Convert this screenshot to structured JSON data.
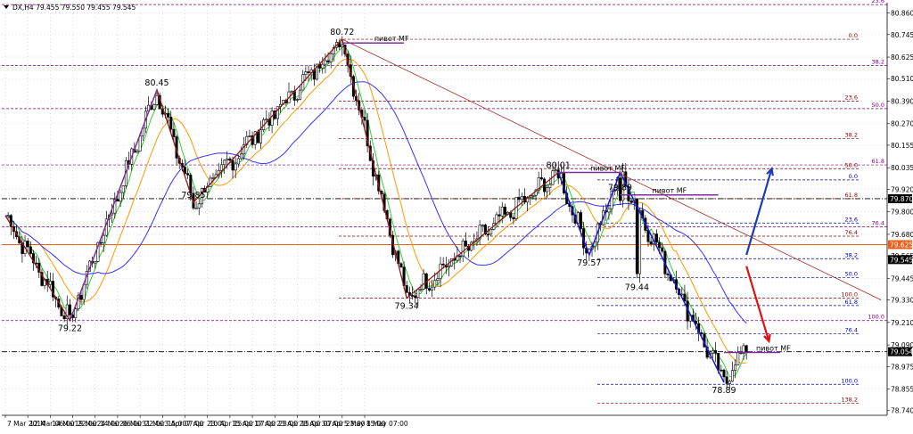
{
  "chart_data": {
    "type": "candlestick",
    "symbol_line": "DX,H4  79.455 79.550 79.455 79.545",
    "colors": {
      "grid": "#c8c8c8",
      "candle_up": "#ffffff",
      "candle_down": "#000000",
      "ma_fast": "#33cc33",
      "ma_mid": "#ff9900",
      "ma_slow": "#3333ff",
      "zigzag_major": "#8b1a1a",
      "zigzag_purple": "#7b2fa0",
      "zigzag_blue": "#1a1acc",
      "trendline": "#a52a2a",
      "fib_level": "#800080",
      "fib_blue": "#0000aa",
      "fib_brown": "#8b0000",
      "arrow_up": "#1a3cb5",
      "arrow_down": "#dd1111",
      "level_orange": "#e8601c"
    },
    "price_axis": {
      "ylim": [
        78.715,
        80.915
      ],
      "ticks": [
        "80.860",
        "80.745",
        "80.625",
        "80.510",
        "80.390",
        "80.270",
        "80.155",
        "80.035",
        "79.920",
        "79.800",
        "79.680",
        "79.565",
        "79.445",
        "79.330",
        "79.210",
        "79.090",
        "78.975",
        "78.855",
        "78.740"
      ],
      "tags": [
        {
          "label": "79.870",
          "price": 79.87,
          "color": "#000000"
        },
        {
          "label": "79.625",
          "price": 79.625,
          "color": "#e8601c"
        },
        {
          "label": "79.545",
          "price": 79.545,
          "color": "#000000"
        },
        {
          "label": "79.054",
          "price": 79.054,
          "color": "#000000"
        }
      ]
    },
    "time_axis": {
      "bars": 183,
      "ticks": [
        {
          "label": "7 Mar 2014",
          "bar": 0
        },
        {
          "label": "12 Mar 06:00",
          "bar": 16
        },
        {
          "label": "14 Mar 22:00",
          "bar": 32
        },
        {
          "label": "19 Mar 14:00",
          "bar": 48
        },
        {
          "label": "24 Mar 06:00",
          "bar": 64
        },
        {
          "label": "26 Mar 22:00",
          "bar": 80
        },
        {
          "label": "31 Mar 15:00",
          "bar": 96
        },
        {
          "label": "3 Apr 07:00",
          "bar": 112
        },
        {
          "label": "7 Apr 23:00",
          "bar": 128
        },
        {
          "label": "10 Apr 15:00",
          "bar": 144
        },
        {
          "label": "15 Apr 07:00",
          "bar": 160
        },
        {
          "label": "17 Apr 23:00",
          "bar": 176
        },
        {
          "label": "23 Apr 15:00",
          "bar": 192
        },
        {
          "label": "28 Apr 07:00",
          "bar": 208
        },
        {
          "label": "30 Apr 23:00",
          "bar": 224
        },
        {
          "label": "5 May 15:00",
          "bar": 240
        },
        {
          "label": "8 May 07:00",
          "bar": 256
        }
      ]
    },
    "swing_points": [
      {
        "label": "79.22",
        "bar": 23,
        "price": 79.22
      },
      {
        "label": "80.45",
        "bar": 54,
        "price": 80.45
      },
      {
        "label": "79.85",
        "bar": 67,
        "price": 79.85
      },
      {
        "label": "80.72",
        "bar": 120,
        "price": 80.72
      },
      {
        "label": "79.34",
        "bar": 143,
        "price": 79.34
      },
      {
        "label": "80.01",
        "bar": 197,
        "price": 80.01
      },
      {
        "label": "79.57",
        "bar": 208,
        "price": 79.57
      },
      {
        "label": "79.89",
        "bar": 219,
        "price": 79.89
      },
      {
        "label": "79.44",
        "bar": 225,
        "price": 79.44
      },
      {
        "label": "78.89",
        "bar": 256,
        "price": 78.89
      }
    ],
    "zigzag_major": [
      [
        0,
        79.78
      ],
      [
        23,
        79.22
      ],
      [
        54,
        80.45
      ],
      [
        67,
        79.85
      ],
      [
        120,
        80.72
      ],
      [
        143,
        79.34
      ],
      [
        197,
        80.01
      ],
      [
        208,
        79.57
      ],
      [
        219,
        80.01
      ],
      [
        256,
        78.89
      ]
    ],
    "zigzag_purple": [
      [
        23,
        79.22
      ],
      [
        54,
        80.45
      ]
    ],
    "trendline": [
      [
        120,
        80.72
      ],
      [
        312,
        79.33
      ]
    ],
    "pivot_labels": [
      {
        "label": "пивот MF",
        "bar": 120,
        "bar_end": 142,
        "price": 80.7
      },
      {
        "label": "пивот MF",
        "bar": 197,
        "bar_end": 219,
        "price": 80.01
      },
      {
        "label": "пивот MF",
        "bar": 219,
        "bar_end": 254,
        "price": 79.89
      },
      {
        "label": "пивот MF",
        "bar": 256,
        "bar_end": 276,
        "price": 79.05
      }
    ],
    "fib_levels": [
      {
        "label": "23.6",
        "price": 80.905,
        "color": "#800080",
        "side": "axis"
      },
      {
        "label": "38.2",
        "price": 80.58,
        "color": "#800080",
        "side": "axis"
      },
      {
        "label": "61.8",
        "price": 80.05,
        "color": "#800080",
        "side": "axis"
      },
      {
        "label": "76.4",
        "price": 79.72,
        "color": "#800080",
        "side": "axis"
      },
      {
        "label": "100.0",
        "price": 79.22,
        "color": "#800080",
        "side": "axis"
      },
      {
        "label": "0.0",
        "price": 80.72,
        "color": "#8b0000",
        "side": "mid"
      },
      {
        "label": "23.6",
        "price": 80.39,
        "color": "#8b0000",
        "side": "mid"
      },
      {
        "label": "38.2",
        "price": 80.19,
        "color": "#8b0000",
        "side": "mid"
      },
      {
        "label": "50.0",
        "price": 80.03,
        "color": "#8b0000",
        "side": "mid"
      },
      {
        "label": "61.8",
        "price": 79.87,
        "color": "#8b0000",
        "side": "mid"
      },
      {
        "label": "76.4",
        "price": 79.67,
        "color": "#8b0000",
        "side": "mid"
      },
      {
        "label": "100.0",
        "price": 79.34,
        "color": "#8b0000",
        "side": "mid"
      },
      {
        "label": "0.0",
        "price": 79.97,
        "color": "#0000aa",
        "side": "mid2"
      },
      {
        "label": "23.6",
        "price": 79.74,
        "color": "#0000aa",
        "side": "mid2"
      },
      {
        "label": "38.2",
        "price": 79.55,
        "color": "#0000aa",
        "side": "mid2"
      },
      {
        "label": "50.0",
        "price": 79.45,
        "color": "#0000aa",
        "side": "mid2"
      },
      {
        "label": "61.8",
        "price": 79.3,
        "color": "#0000aa",
        "side": "mid2"
      },
      {
        "label": "76.4",
        "price": 79.15,
        "color": "#0000aa",
        "side": "mid2"
      },
      {
        "label": "100.0",
        "price": 78.88,
        "color": "#0000aa",
        "side": "mid2"
      },
      {
        "label": "138.2",
        "price": 78.78,
        "color": "#8b0000",
        "side": "mid2"
      },
      {
        "label": "50.0",
        "price": 80.35,
        "color": "#800080",
        "side": "axis"
      }
    ],
    "horizontal_lines": [
      {
        "price": 79.87,
        "style": "dashdot",
        "color": "#000000"
      },
      {
        "price": 79.625,
        "style": "solid",
        "color": "#e8601c"
      },
      {
        "price": 79.054,
        "style": "dashdot",
        "color": "#000000"
      }
    ],
    "forecast_arrows": [
      {
        "color": "#1a3cb5",
        "from": [
          264,
          79.57
        ],
        "to": [
          273,
          80.03
        ]
      },
      {
        "color": "#dd1111",
        "from": [
          264,
          79.51
        ],
        "to": [
          272,
          79.11
        ]
      }
    ]
  }
}
